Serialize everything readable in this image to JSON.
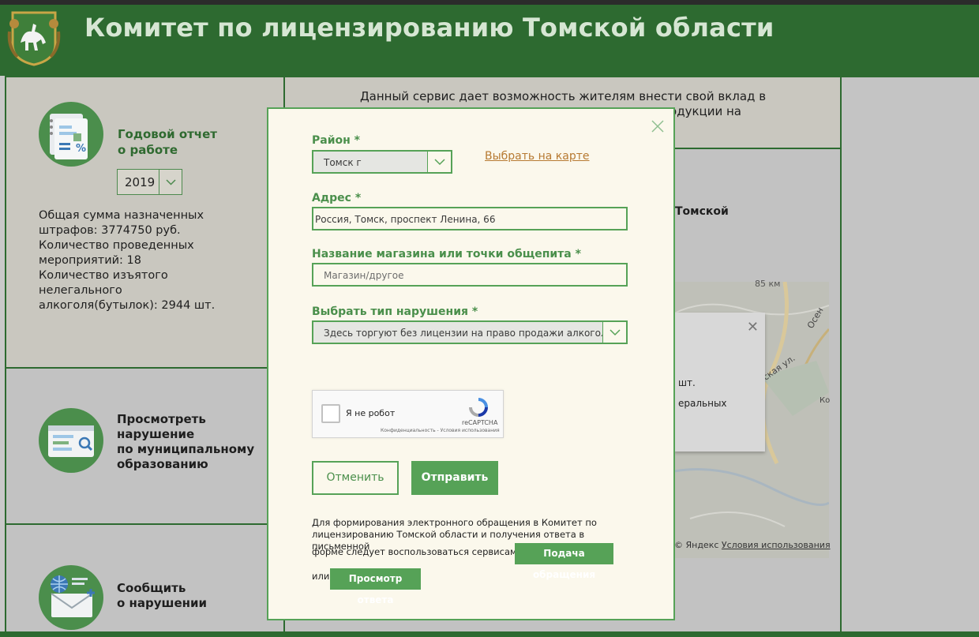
{
  "header": {
    "title": "Комитет по лицензированию Томской области"
  },
  "left_panel": {
    "report_title_line1": "Годовой отчет",
    "report_title_line2": "о работе",
    "year_value": "2019",
    "stats": [
      "Общая сумма назначенных",
      "штрафов: 3774750 руб.",
      "Количество проведенных",
      "мероприятий: 18",
      "Количество изъятого",
      "нелегального",
      "алкоголя(бутылок): 2944 шт."
    ],
    "view_violation": [
      "Просмотреть",
      "нарушение",
      "по муниципальному",
      "образованию"
    ],
    "report_violation": [
      "Сообщить",
      "о нарушении"
    ]
  },
  "middle_panel": {
    "intro_line1": "Данный сервис дает возможность жителям внести свой вклад в",
    "intro_line2_left": "",
    "intro_line2_right": "родукции на",
    "tomsk_label": "Томской",
    "map_distance": "85 км",
    "map_street": "йская ул.",
    "map_osen": "Осен",
    "map_ko": "Ко",
    "map_popup_line1": "шт.",
    "map_popup_line2": "еральных",
    "map_footer_prefix": "© Яндекс",
    "map_footer_link": "Условия использования"
  },
  "modal": {
    "district_label": "Район *",
    "district_value": "Томск г",
    "map_select_link": "Выбрать на карте",
    "address_label": "Адрес *",
    "address_value": "Россия, Томск, проспект Ленина, 66",
    "shop_label": "Название магазина или точки общепита *",
    "shop_placeholder": "Магазин/другое",
    "violation_label": "Выбрать тип нарушения *",
    "violation_value": "Здесь торгуют без лицензии на право продажи алкоголя!",
    "captcha_label": "Я не робот",
    "captcha_brand": "reCAPTCHA",
    "captcha_small": "Конфиденциальность - Условия использования",
    "cancel_label": "Отменить",
    "send_label": "Отправить",
    "info_line1": "Для формирования электронного обращения в Комитет по",
    "info_line2": "лицензированию Томской области и получения ответа в письменной",
    "info_line3": "форме следует воспользоваться сервисами:",
    "submit_appeal_label": "Подача обращения",
    "or_label": "или",
    "view_answer_label": "Просмотр ответа"
  },
  "colors": {
    "header_green": "#2d6a30",
    "accent_green": "#56a257",
    "modal_bg": "#fbf8ec",
    "link_orange": "#b77a32"
  }
}
